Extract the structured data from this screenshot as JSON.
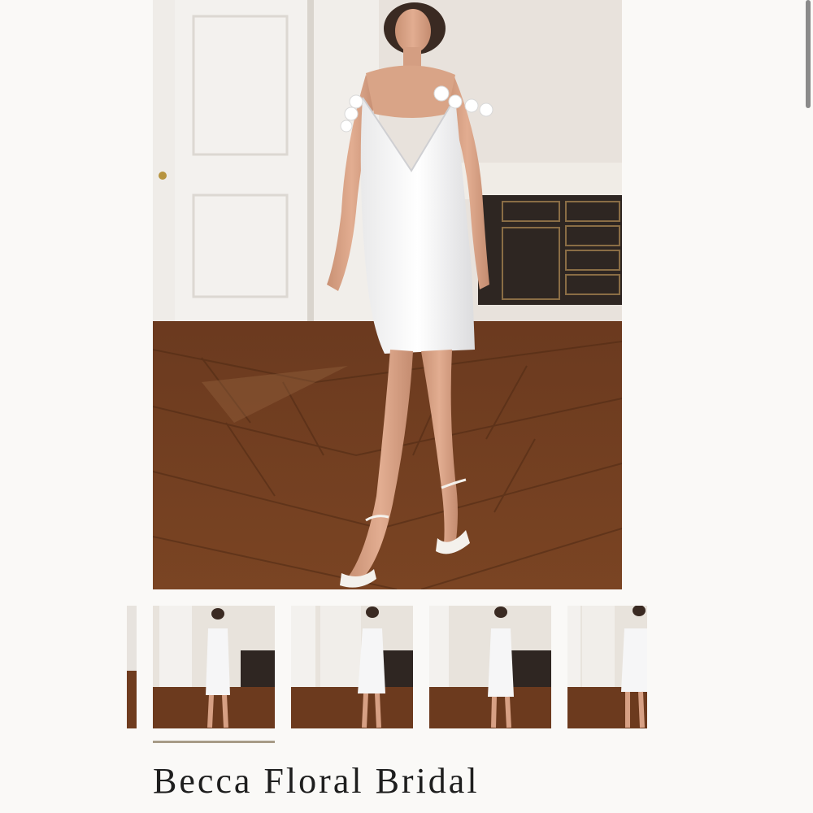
{
  "product": {
    "title": "Becca Floral Bridal"
  },
  "gallery": {
    "main_image": "model-in-white-satin-slip-dress",
    "thumbnails": [
      {
        "name": "thumbnail-previous-partial",
        "selected": false
      },
      {
        "name": "thumbnail-1",
        "selected": true
      },
      {
        "name": "thumbnail-2",
        "selected": false
      },
      {
        "name": "thumbnail-3",
        "selected": false
      },
      {
        "name": "thumbnail-4-partial",
        "selected": false
      }
    ]
  },
  "colors": {
    "background": "#faf9f7",
    "accent_indicator": "#a79b87",
    "title_text": "#1e1e1e"
  }
}
